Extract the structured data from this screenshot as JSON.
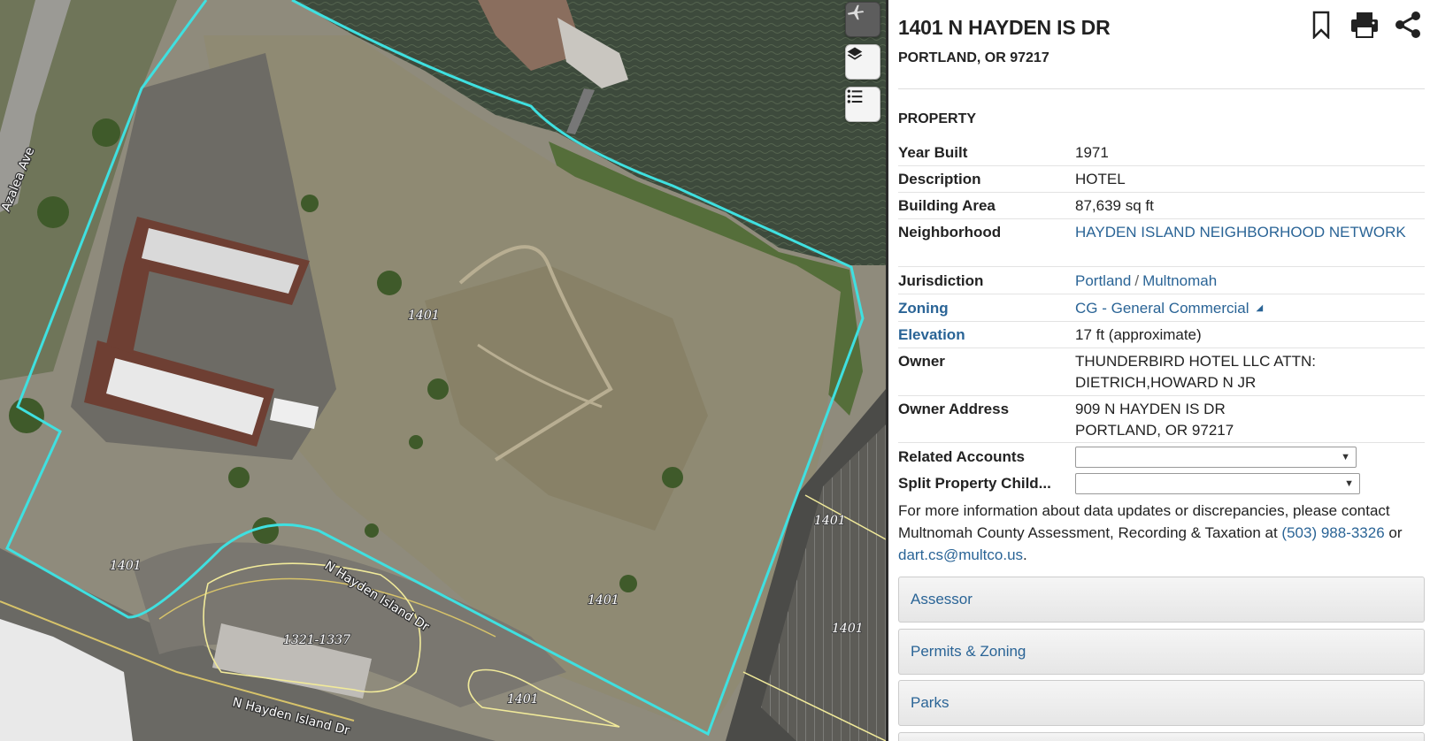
{
  "map": {
    "parcel_labels": [
      "1401",
      "1401",
      "1401",
      "1401",
      "1401",
      "1401"
    ],
    "building_label": "1321-1337",
    "street_labels": [
      "N Hayden Island Dr",
      "N Hayden Island Dr",
      "Azalea Ave"
    ],
    "tools": [
      {
        "icon": "airplane-icon"
      },
      {
        "icon": "layers-icon"
      },
      {
        "icon": "list-icon"
      }
    ],
    "colors": {
      "parcel_outline": "#3fe0e0",
      "lot_outline": "#f1ea9a",
      "water": "#3b4a3a"
    }
  },
  "header": {
    "address": "1401 N HAYDEN IS DR",
    "city": "PORTLAND, OR 97217",
    "icons": [
      "bookmark-icon",
      "print-icon",
      "share-icon"
    ]
  },
  "property": {
    "title": "PROPERTY",
    "year_built_label": "Year Built",
    "year_built": "1971",
    "description_label": "Description",
    "description": "HOTEL",
    "building_area_label": "Building Area",
    "building_area": "87,639 sq ft",
    "neighborhood_label": "Neighborhood",
    "neighborhood": "HAYDEN ISLAND NEIGHBORHOOD NETWORK",
    "jurisdiction_label": "Jurisdiction",
    "jurisdiction_city": "Portland",
    "jurisdiction_sep": "/",
    "jurisdiction_county": "Multnomah",
    "zoning_label": "Zoning",
    "zoning": "CG - General Commercial",
    "elevation_label": "Elevation",
    "elevation": "17 ft (approximate)",
    "owner_label": "Owner",
    "owner_line1": "THUNDERBIRD HOTEL LLC ATTN:",
    "owner_line2": "DIETRICH,HOWARD N JR",
    "owner_address_label": "Owner Address",
    "owner_address_line1": "909 N HAYDEN IS DR",
    "owner_address_line2": "PORTLAND, OR 97217",
    "related_accounts_label": "Related Accounts",
    "related_accounts_value": "",
    "split_property_label": "Split Property Child...",
    "split_property_value": ""
  },
  "info": {
    "text": "For more information about data updates or discrepancies, please contact Multnomah County Assessment, Recording & Taxation at",
    "phone": "(503) 988-3326",
    "or": "or",
    "email": "dart.cs@multco.us",
    "period": "."
  },
  "accordions": [
    "Assessor",
    "Permits & Zoning",
    "Parks"
  ],
  "colors": {
    "link": "#2a6496",
    "text": "#222222"
  }
}
